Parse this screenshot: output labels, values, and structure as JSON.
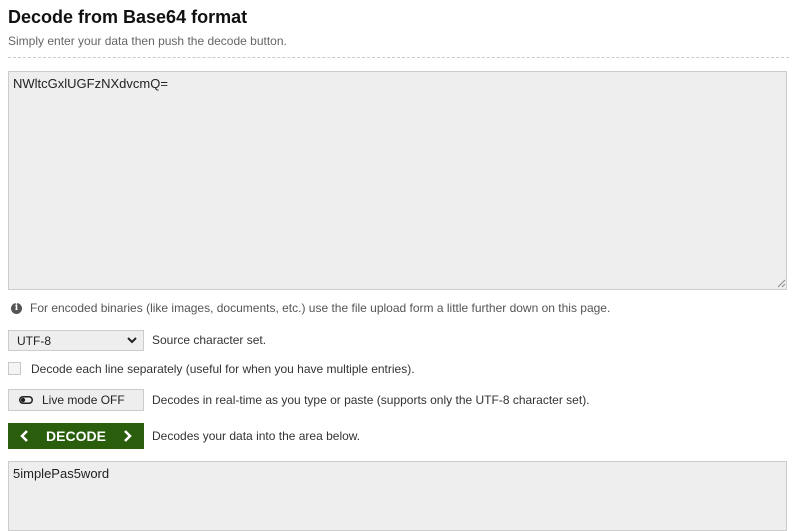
{
  "header": {
    "title": "Decode from Base64 format",
    "subtitle": "Simply enter your data then push the decode button."
  },
  "input": {
    "value": "NWltcGxlUGFzNXdvcmQ="
  },
  "note": {
    "icon": "info-icon",
    "text": "For encoded binaries (like images, documents, etc.) use the file upload form a little further down on this page."
  },
  "charset": {
    "selected": "UTF-8",
    "label": "Source character set."
  },
  "separate_lines": {
    "checked": false,
    "label": "Decode each line separately (useful for when you have multiple entries)."
  },
  "live_mode": {
    "button_label": "Live mode OFF",
    "icon": "toggle-off-icon",
    "description": "Decodes in real-time as you type or paste (supports only the UTF-8 character set)."
  },
  "decode": {
    "button_label": "DECODE",
    "description": "Decodes your data into the area below."
  },
  "output": {
    "value": "5implePas5word"
  },
  "colors": {
    "decode_button": "#2b5e0c",
    "textarea_bg": "#eeeeee"
  }
}
